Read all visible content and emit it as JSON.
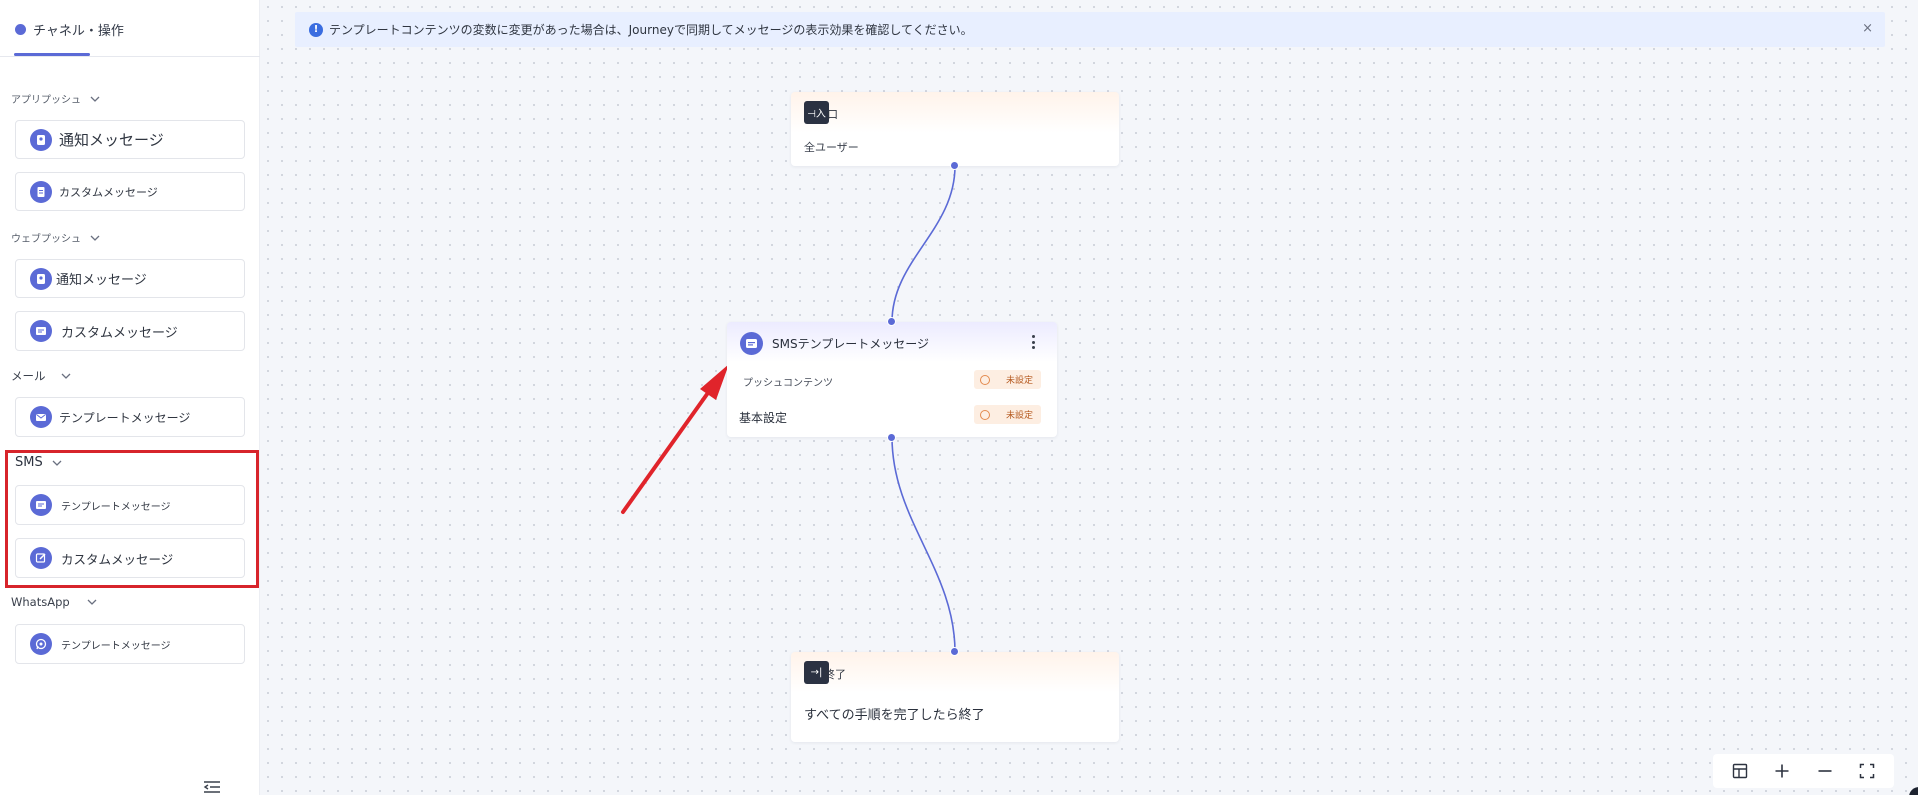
{
  "sidebar": {
    "tab_label": "チャネル・操作",
    "collapse_icon": "collapse-left-icon",
    "groups": [
      {
        "title": "アプリプッシュ",
        "items": [
          {
            "label": "通知メッセージ",
            "icon": "notification-icon"
          },
          {
            "label": "カスタムメッセージ",
            "icon": "document-icon"
          }
        ]
      },
      {
        "title": "ウェブプッシュ",
        "items": [
          {
            "label": "通知メッセージ",
            "icon": "notification-icon"
          },
          {
            "label": "カスタムメッセージ",
            "icon": "message-icon"
          }
        ]
      },
      {
        "title": "メール",
        "items": [
          {
            "label": "テンプレートメッセージ",
            "icon": "mail-icon"
          }
        ]
      },
      {
        "title": "SMS",
        "items": [
          {
            "label": "テンプレートメッセージ",
            "icon": "sms-icon"
          },
          {
            "label": "カスタムメッセージ",
            "icon": "edit-icon"
          }
        ]
      },
      {
        "title": "WhatsApp",
        "items": [
          {
            "label": "テンプレートメッセージ",
            "icon": "whatsapp-icon"
          }
        ]
      }
    ]
  },
  "notice": {
    "message": "テンプレートコンテンツの変数に変更があった場合は、Journeyで同期してメッセージの表示効果を確認してください。",
    "close": "×"
  },
  "flow": {
    "start_node": {
      "badge": "⊣入",
      "title": "口",
      "text": "全ユーザー"
    },
    "sms_node": {
      "title": "SMSテンプレートメッセージ",
      "rows": [
        {
          "label": "プッシュコンテンツ",
          "status": "未設定"
        },
        {
          "label": "基本設定",
          "status": "未設定"
        }
      ]
    },
    "end_node": {
      "badge": "→|",
      "title": "終了",
      "text": "すべての手順を完了したら終了"
    }
  },
  "toolbar": {
    "buttons": [
      "layout-icon",
      "zoom-in-icon",
      "zoom-out-icon",
      "fullscreen-icon"
    ]
  },
  "colors": {
    "accent": "#5b6ad6",
    "highlight_red": "#d7242b",
    "status_bg": "#fdeee2",
    "notice_bg": "#e8efff"
  }
}
